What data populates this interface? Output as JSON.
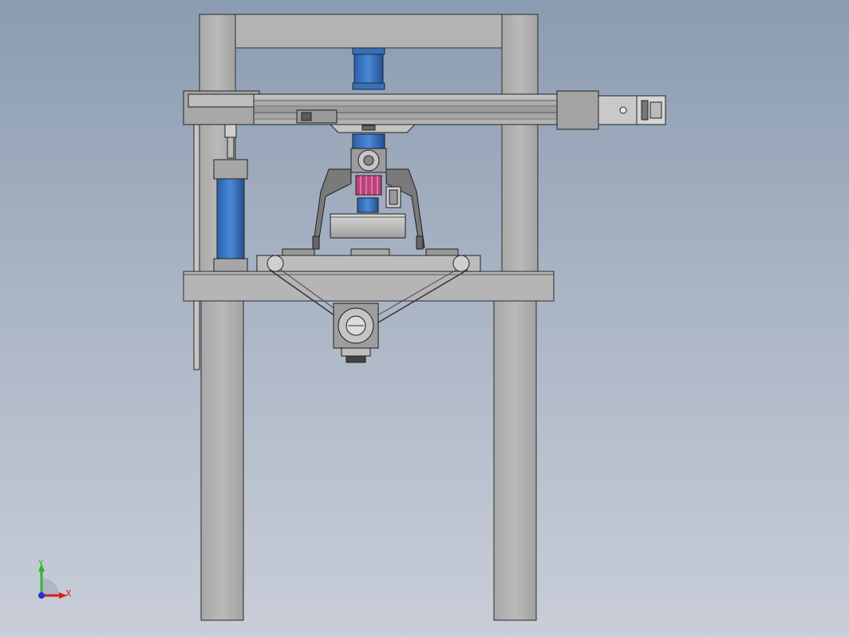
{
  "viewport": {
    "background_top": "#8b9cb1",
    "background_bottom": "#c9ced8"
  },
  "model": {
    "frame_color": "#b1b1b1",
    "edge_color": "#2a2a2a",
    "accent_blue": "#3a78c8",
    "accent_magenta": "#c0407a"
  },
  "triad": {
    "y_label": "Y",
    "x_label": "X",
    "y_color": "#2fb52f",
    "x_color": "#d42020",
    "z_color": "#1f2fcf"
  }
}
